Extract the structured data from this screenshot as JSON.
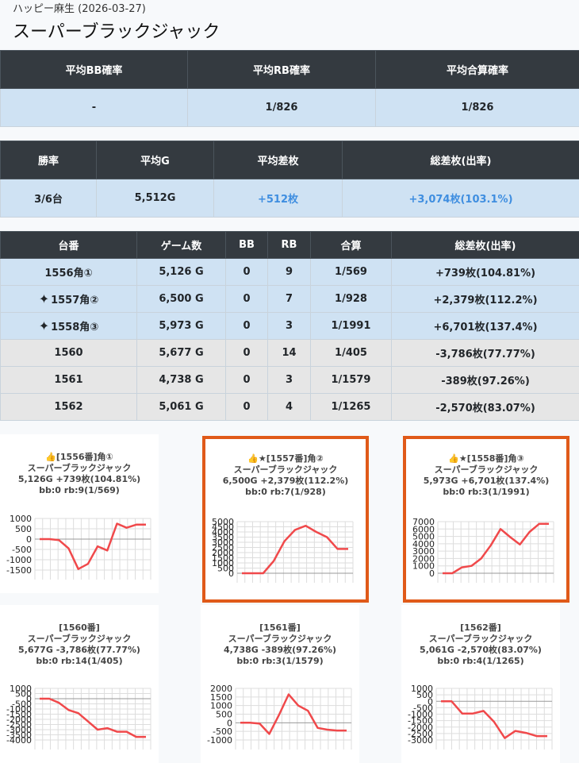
{
  "breadcrumb": "ハッピー麻生 (2026-03-27)",
  "page_title": "スーパーブラックジャック",
  "summary1": {
    "headers": [
      "平均BB確率",
      "平均RB確率",
      "平均合算確率"
    ],
    "values": [
      "-",
      "1/826",
      "1/826"
    ]
  },
  "summary2": {
    "headers": [
      "勝率",
      "平均G",
      "平均差枚",
      "総差枚(出率)"
    ],
    "values": [
      "3/6台",
      "5,512G",
      "+512枚",
      "+3,074枚(103.1%)"
    ]
  },
  "machines": {
    "headers": [
      "台番",
      "ゲーム数",
      "BB",
      "RB",
      "合算",
      "総差枚(出率)"
    ],
    "rows": [
      {
        "no": "1556角①",
        "games": "5,126 G",
        "bb": "0",
        "rb": "9",
        "combined": "1/569",
        "diff": "+739枚(104.81%)",
        "sparkle": false
      },
      {
        "no": "1557角②",
        "games": "6,500 G",
        "bb": "0",
        "rb": "7",
        "combined": "1/928",
        "diff": "+2,379枚(112.2%)",
        "sparkle": true
      },
      {
        "no": "1558角③",
        "games": "5,973 G",
        "bb": "0",
        "rb": "3",
        "combined": "1/1991",
        "diff": "+6,701枚(137.4%)",
        "sparkle": true
      },
      {
        "no": "1560",
        "games": "5,677 G",
        "bb": "0",
        "rb": "14",
        "combined": "1/405",
        "diff": "-3,786枚(77.77%)",
        "sparkle": false
      },
      {
        "no": "1561",
        "games": "4,738 G",
        "bb": "0",
        "rb": "3",
        "combined": "1/1579",
        "diff": "-389枚(97.26%)",
        "sparkle": false
      },
      {
        "no": "1562",
        "games": "5,061 G",
        "bb": "0",
        "rb": "4",
        "combined": "1/1265",
        "diff": "-2,570枚(83.07%)",
        "sparkle": false
      }
    ]
  },
  "icons": {
    "sparkle": "sparkle-icon",
    "thumbs_up": "thumbs-up-icon",
    "star": "star-icon"
  },
  "colors": {
    "header_bg": "#343a40",
    "row_blue": "#cfe2f3",
    "row_gray": "#e6e6e6",
    "positive": "#3f8ee0",
    "highlight_border": "#e05a19",
    "line": "#f0494b"
  },
  "chart_data": [
    {
      "type": "line",
      "caption": [
        "👍[1556番]角①",
        "スーパーブラックジャック",
        "5,126G +739枚(104.81%)",
        "bb:0 rb:9(1/569)"
      ],
      "x": [
        0,
        1,
        2,
        3,
        4,
        5,
        6,
        7,
        8,
        9,
        10
      ],
      "values": [
        0,
        0,
        -50,
        -450,
        -1450,
        -1200,
        -350,
        -550,
        750,
        550,
        700,
        700
      ],
      "yticks": [
        1000,
        500,
        0,
        -500,
        -1000,
        -1500
      ],
      "ylim": [
        -1650,
        1100
      ]
    },
    {
      "type": "line",
      "caption": [
        "👍★[1557番]角②",
        "スーパーブラックジャック",
        "6,500G +2,379枚(112.2%)",
        "bb:0 rb:7(1/928)"
      ],
      "values": [
        0,
        0,
        0,
        1200,
        3100,
        4200,
        4600,
        4000,
        3500,
        2350,
        2350
      ],
      "yticks": [
        5000,
        4500,
        4000,
        3500,
        3000,
        2500,
        2000,
        1500,
        1000,
        500,
        0
      ],
      "ylim": [
        -100,
        5000
      ]
    },
    {
      "type": "line",
      "caption": [
        "👍★[1558番]角③",
        "スーパーブラックジャック",
        "5,973G +6,701枚(137.4%)",
        "bb:0 rb:3(1/1991)"
      ],
      "values": [
        0,
        0,
        800,
        1000,
        2000,
        3800,
        6000,
        4900,
        3900,
        5600,
        6700,
        6700
      ],
      "yticks": [
        7000,
        6000,
        5000,
        4000,
        3000,
        2000,
        1000,
        0
      ],
      "ylim": [
        -200,
        7000
      ]
    },
    {
      "type": "line",
      "caption": [
        "[1560番]",
        "スーパーブラックジャック",
        "5,677G -3,786枚(77.77%)",
        "bb:0 rb:14(1/405)"
      ],
      "values": [
        0,
        0,
        -400,
        -1100,
        -1400,
        -2200,
        -3000,
        -2850,
        -3200,
        -3200,
        -3700,
        -3700
      ],
      "yticks": [
        1000,
        500,
        0,
        -500,
        -1000,
        -1500,
        -2000,
        -2500,
        -3000,
        -3500,
        -4000
      ],
      "ylim": [
        -4100,
        1000
      ]
    },
    {
      "type": "line",
      "caption": [
        "[1561番]",
        "スーパーブラックジャック",
        "4,738G -389枚(97.26%)",
        "bb:0 rb:3(1/1579)"
      ],
      "values": [
        0,
        0,
        -50,
        -650,
        450,
        1650,
        1000,
        700,
        -300,
        -400,
        -450,
        -450
      ],
      "yticks": [
        2000,
        1500,
        1000,
        500,
        0,
        -500,
        -1000
      ],
      "ylim": [
        -1100,
        2000
      ]
    },
    {
      "type": "line",
      "caption": [
        "[1562番]",
        "スーパーブラックジャック",
        "5,061G -2,570枚(83.07%)",
        "bb:0 rb:4(1/1265)"
      ],
      "values": [
        0,
        0,
        -950,
        -950,
        -750,
        -1600,
        -2850,
        -2300,
        -2450,
        -2700,
        -2700
      ],
      "yticks": [
        1000,
        500,
        0,
        -500,
        -1000,
        -1500,
        -2000,
        -2500,
        -3000
      ],
      "ylim": [
        -3100,
        1000
      ]
    }
  ]
}
